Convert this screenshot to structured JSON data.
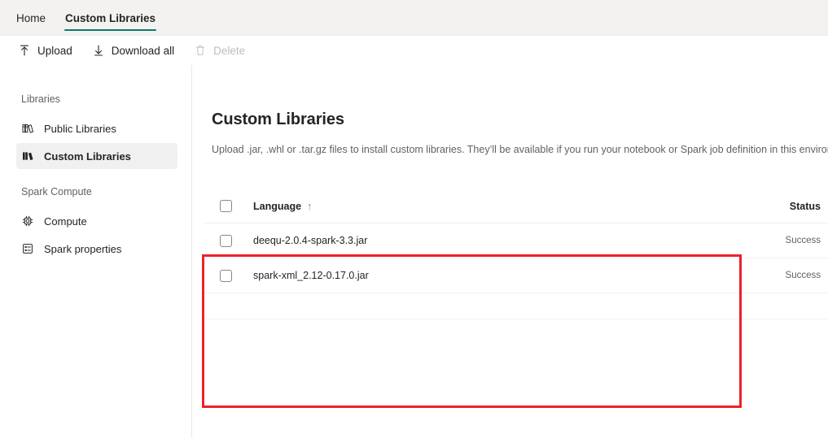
{
  "tabs": [
    {
      "label": "Home",
      "active": false
    },
    {
      "label": "Custom Libraries",
      "active": true
    }
  ],
  "toolbar": {
    "upload_label": "Upload",
    "download_all_label": "Download all",
    "delete_label": "Delete",
    "upload_icon": "upload-arrow-icon",
    "download_icon": "download-arrow-icon",
    "delete_icon": "trash-icon"
  },
  "sidebar": {
    "groups": [
      {
        "title": "Libraries",
        "items": [
          {
            "label": "Public Libraries",
            "icon": "books-outline-icon",
            "selected": false
          },
          {
            "label": "Custom Libraries",
            "icon": "books-filled-icon",
            "selected": true
          }
        ]
      },
      {
        "title": "Spark Compute",
        "items": [
          {
            "label": "Compute",
            "icon": "cpu-chip-icon",
            "selected": false
          },
          {
            "label": "Spark properties",
            "icon": "list-document-icon",
            "selected": false
          }
        ]
      }
    ]
  },
  "main": {
    "title": "Custom Libraries",
    "subtitle": "Upload .jar, .whl or .tar.gz files to install custom libraries. They’ll be available if you run your notebook or Spark job definition in this environment"
  },
  "table": {
    "columns": {
      "language": "Language",
      "status": "Status"
    },
    "sort": {
      "column": "Language",
      "direction": "ascending",
      "glyph": "↑"
    },
    "rows": [
      {
        "name": "deequ-2.0.4-spark-3.3.jar",
        "status": "Success",
        "checked": false
      },
      {
        "name": "spark-xml_2.12-0.17.0.jar",
        "status": "Success",
        "checked": false
      }
    ]
  },
  "annotation": {
    "shape": "rectangle",
    "color": "#ec2228"
  },
  "colors": {
    "accent_underline": "#117865",
    "ribbon_background": "#f3f2f1",
    "selected_nav_background": "#f0f0f0",
    "annotation_red": "#ec2228",
    "sort_arrow": "#6e9c94"
  }
}
